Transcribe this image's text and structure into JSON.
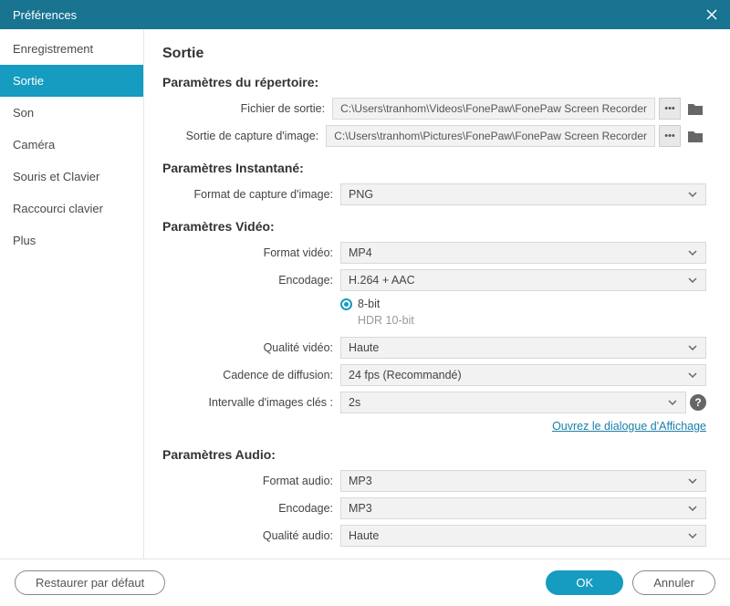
{
  "window": {
    "title": "Préférences"
  },
  "sidebar": {
    "items": [
      {
        "label": "Enregistrement"
      },
      {
        "label": "Sortie"
      },
      {
        "label": "Son"
      },
      {
        "label": "Caméra"
      },
      {
        "label": "Souris et Clavier"
      },
      {
        "label": "Raccourci clavier"
      },
      {
        "label": "Plus"
      }
    ],
    "active_index": 1
  },
  "page": {
    "title": "Sortie",
    "dir": {
      "heading": "Paramètres du répertoire:",
      "output_file_label": "Fichier de sortie:",
      "output_file_value": "C:\\Users\\tranhom\\Videos\\FonePaw\\FonePaw Screen Recorder",
      "capture_output_label": "Sortie de capture d'image:",
      "capture_output_value": "C:\\Users\\tranhom\\Pictures\\FonePaw\\FonePaw Screen Recorder",
      "more_button": "•••"
    },
    "snapshot": {
      "heading": "Paramètres Instantané:",
      "format_label": "Format de capture d'image:",
      "format_value": "PNG"
    },
    "video": {
      "heading": "Paramètres Vidéo:",
      "format_label": "Format vidéo:",
      "format_value": "MP4",
      "encoding_label": "Encodage:",
      "encoding_value": "H.264 + AAC",
      "bit_depth_8": "8-bit",
      "bit_depth_hdr": "HDR 10-bit",
      "quality_label": "Qualité vidéo:",
      "quality_value": "Haute",
      "framerate_label": "Cadence de diffusion:",
      "framerate_value": "24 fps (Recommandé)",
      "keyframe_label": "Intervalle d'images clés :",
      "keyframe_value": "2s",
      "display_link": "Ouvrez le dialogue d'Affichage"
    },
    "audio": {
      "heading": "Paramètres Audio:",
      "format_label": "Format audio:",
      "format_value": "MP3",
      "encoding_label": "Encodage:",
      "encoding_value": "MP3",
      "quality_label": "Qualité audio:",
      "quality_value": "Haute"
    }
  },
  "footer": {
    "restore": "Restaurer par défaut",
    "ok": "OK",
    "cancel": "Annuler"
  }
}
